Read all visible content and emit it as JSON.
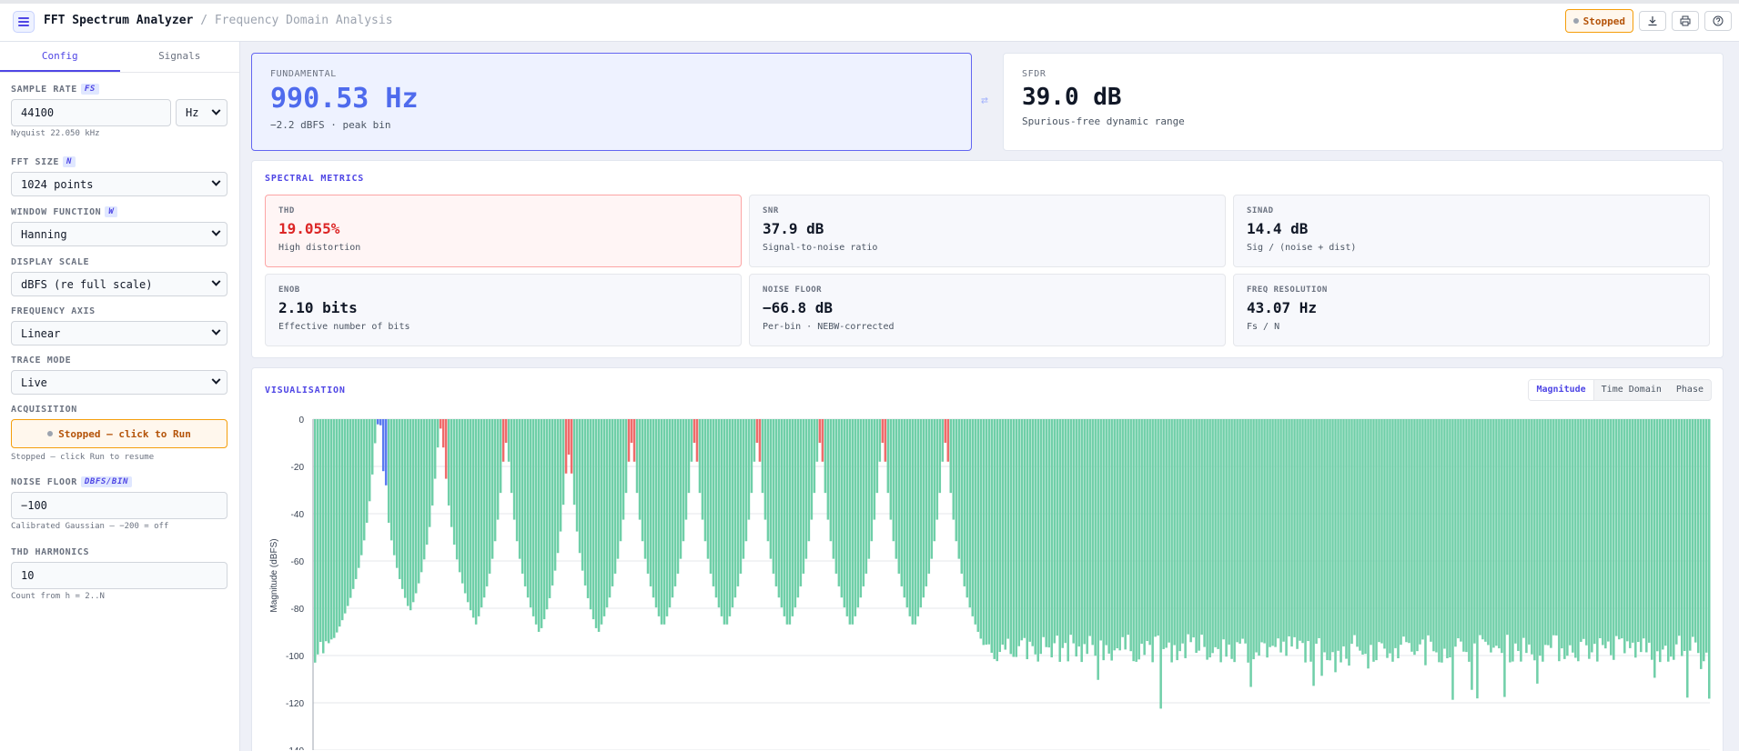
{
  "header": {
    "title": "FFT Spectrum Analyzer",
    "subtitle": "/ Frequency Domain Analysis",
    "status": "Stopped"
  },
  "sidebar": {
    "tabs": [
      "Config",
      "Signals"
    ],
    "sample_rate": {
      "label": "SAMPLE RATE",
      "tag": "FS",
      "value": "44100",
      "unit": "Hz",
      "hint": "Nyquist 22.050 kHz"
    },
    "fft_size": {
      "label": "FFT SIZE",
      "tag": "N",
      "value": "1024 points"
    },
    "window": {
      "label": "WINDOW FUNCTION",
      "tag": "W",
      "value": "Hanning"
    },
    "display_scale": {
      "label": "DISPLAY SCALE",
      "value": "dBFS (re full scale)"
    },
    "freq_axis": {
      "label": "FREQUENCY AXIS",
      "value": "Linear"
    },
    "trace_mode": {
      "label": "TRACE MODE",
      "value": "Live"
    },
    "acquisition": {
      "label": "ACQUISITION",
      "button": "Stopped — click to Run",
      "hint": "Stopped — click Run to resume"
    },
    "noise_floor": {
      "label": "NOISE FLOOR",
      "tag": "DBFS/BIN",
      "value": "−100",
      "hint": "Calibrated Gaussian — −200 = off"
    },
    "thd_harmonics": {
      "label": "THD HARMONICS",
      "value": "10",
      "hint": "Count from h = 2..N"
    }
  },
  "fundamental": {
    "label": "FUNDAMENTAL",
    "value": "990.53 Hz",
    "sub": "−2.2 dBFS · peak bin"
  },
  "sfdr": {
    "label": "SFDR",
    "value": "39.0 dB",
    "sub": "Spurious-free dynamic range"
  },
  "metrics": {
    "title": "SPECTRAL METRICS",
    "items": [
      {
        "label": "THD",
        "value": "19.055%",
        "note": "High distortion"
      },
      {
        "label": "SNR",
        "value": "37.9 dB",
        "note": "Signal-to-noise ratio"
      },
      {
        "label": "SINAD",
        "value": "14.4 dB",
        "note": "Sig / (noise + dist)"
      },
      {
        "label": "ENOB",
        "value": "2.10 bits",
        "note": "Effective number of bits"
      },
      {
        "label": "NOISE FLOOR",
        "value": "−66.8 dB",
        "note": "Per-bin · NEBW-corrected"
      },
      {
        "label": "FREQ RESOLUTION",
        "value": "43.07 Hz",
        "note": "Fs / N"
      }
    ]
  },
  "visualisation": {
    "title": "VISUALISATION",
    "views": [
      "Magnitude",
      "Time Domain",
      "Phase"
    ],
    "active_view": "Magnitude"
  },
  "colors": {
    "accent": "#4f46e5",
    "fundamental": "#5b7bf0",
    "harmonic": "#ef6b6b",
    "noise": "#6fcfa8",
    "warning": "#dc2626"
  },
  "chart_data": {
    "type": "bar",
    "ylabel": "Magnitude (dBFS)",
    "ylim": [
      -140,
      0
    ],
    "yticks": [
      0,
      -20,
      -40,
      -60,
      -80,
      -100,
      -120,
      -140
    ],
    "grid": true,
    "bin_count": 512,
    "fundamental_bins": [
      23,
      24,
      25,
      26
    ],
    "harmonic_bins": [
      46,
      47,
      48,
      69,
      70,
      92,
      93,
      94,
      115,
      116,
      117,
      139,
      140,
      162,
      163,
      185,
      186,
      208,
      209,
      231,
      232
    ],
    "peaks": [
      {
        "bin": 23,
        "db": -2.2,
        "kind": "fundamental"
      },
      {
        "bin": 46,
        "db": -4,
        "kind": "harmonic"
      },
      {
        "bin": 70,
        "db": -10,
        "kind": "harmonic"
      },
      {
        "bin": 93,
        "db": -15,
        "kind": "harmonic"
      },
      {
        "bin": 116,
        "db": -10,
        "kind": "harmonic"
      },
      {
        "bin": 139,
        "db": -10,
        "kind": "harmonic"
      },
      {
        "bin": 162,
        "db": -10,
        "kind": "harmonic"
      },
      {
        "bin": 185,
        "db": -10,
        "kind": "harmonic"
      },
      {
        "bin": 208,
        "db": -10,
        "kind": "harmonic"
      },
      {
        "bin": 231,
        "db": -10,
        "kind": "harmonic"
      }
    ],
    "noise_floor_db": -97
  }
}
